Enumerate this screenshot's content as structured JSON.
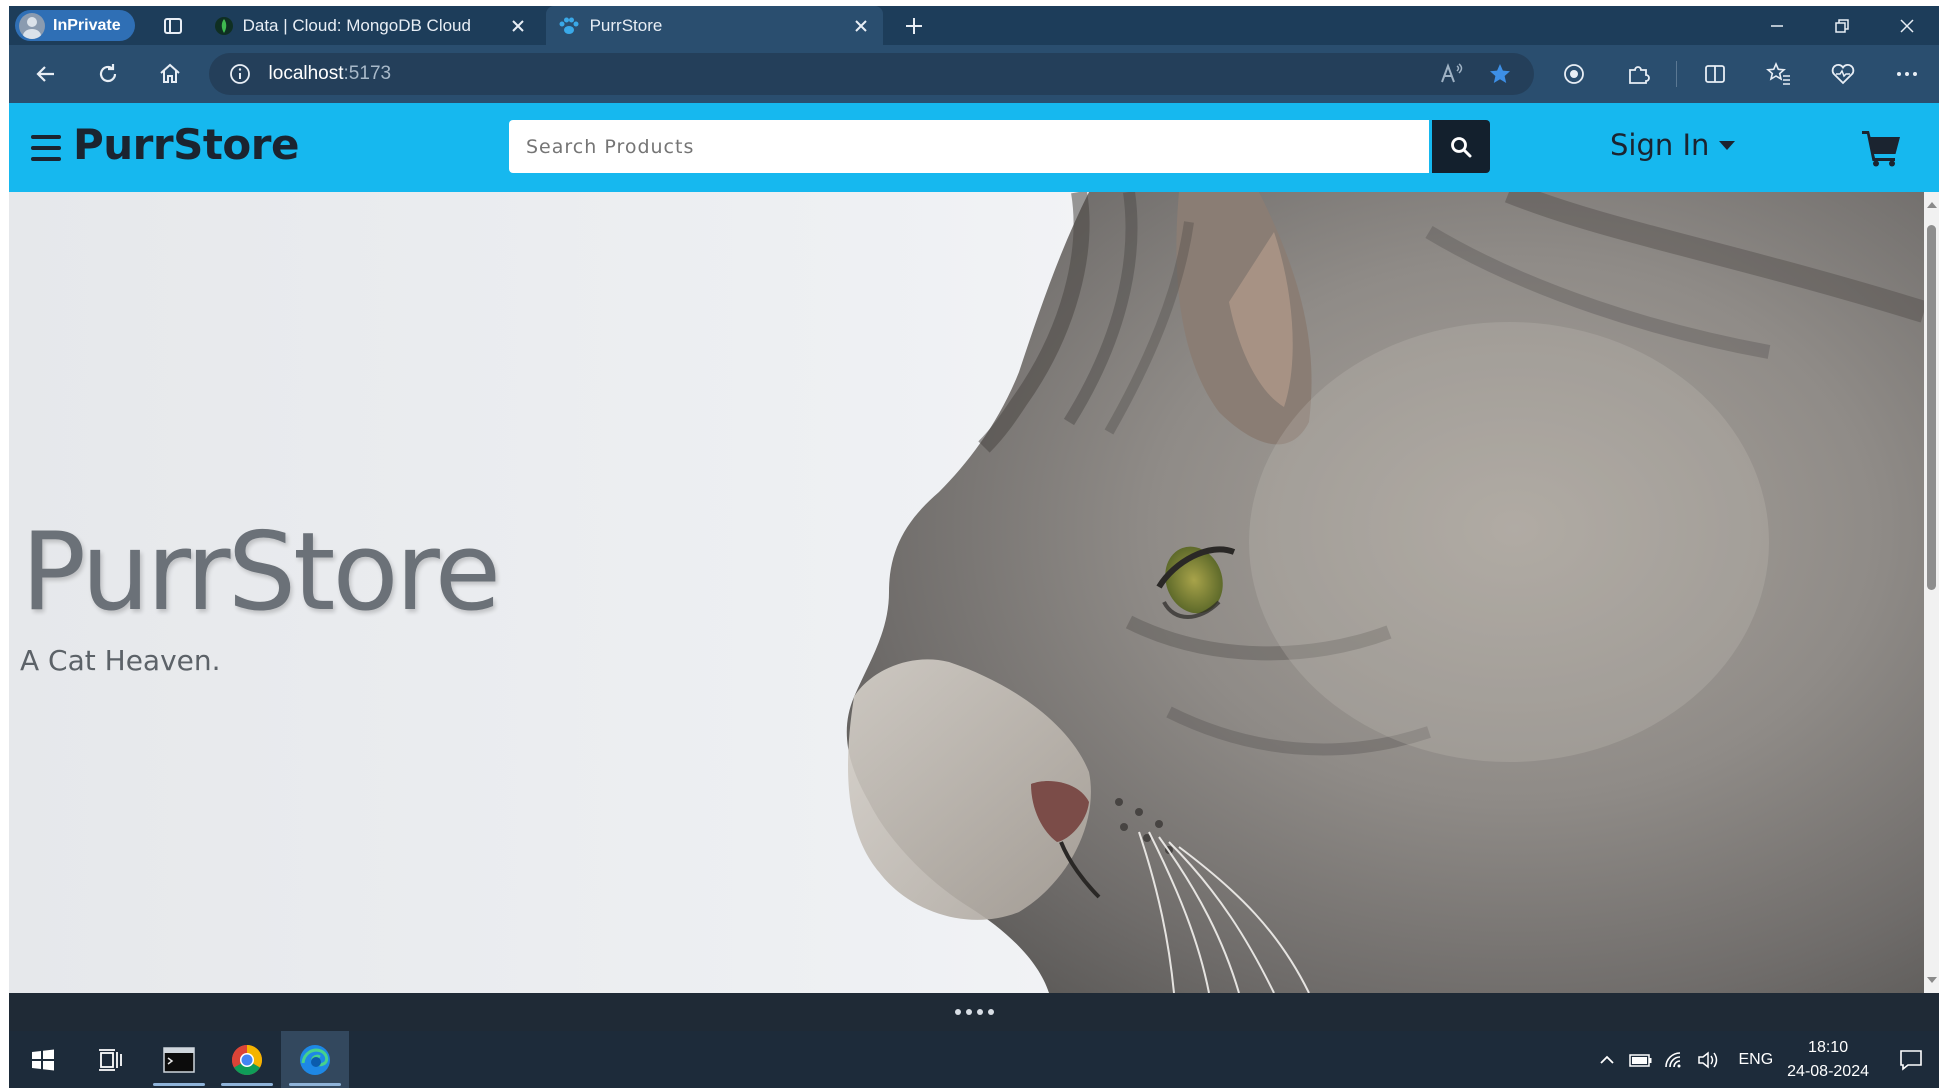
{
  "browser": {
    "profile_label": "InPrivate",
    "tabs": [
      {
        "title": "Data | Cloud: MongoDB Cloud",
        "icon": "mongodb-leaf-icon",
        "active": false
      },
      {
        "title": "PurrStore",
        "icon": "paw-icon",
        "active": true
      }
    ],
    "url_host": "localhost",
    "url_port": ":5173"
  },
  "site": {
    "brand": "PurrStore",
    "search_placeholder": "Search Products",
    "signin_label": "Sign In",
    "accent_color": "#16b8ef"
  },
  "hero": {
    "title": "PurrStore",
    "subtitle": "A Cat Heaven."
  },
  "taskbar": {
    "apps": [
      "start-icon",
      "task-view-icon",
      "terminal-icon",
      "chrome-icon",
      "edge-icon"
    ],
    "language": "ENG",
    "time": "18:10",
    "date": "24-08-2024"
  }
}
